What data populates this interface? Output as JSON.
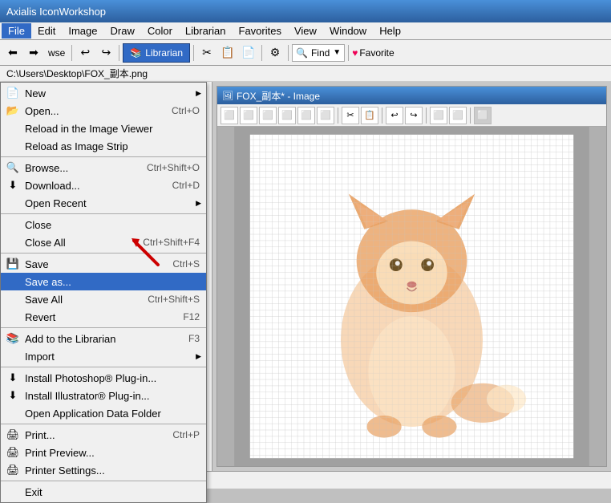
{
  "app": {
    "title": "Axialis IconWorkshop",
    "inner_window_title": "FOX_副本* - Image",
    "path": "C:\\Users\\Desktop\\FOX_副本.png"
  },
  "menu_bar": {
    "items": [
      {
        "id": "file",
        "label": "File",
        "active": true
      },
      {
        "id": "edit",
        "label": "Edit"
      },
      {
        "id": "image",
        "label": "Image"
      },
      {
        "id": "draw",
        "label": "Draw"
      },
      {
        "id": "color",
        "label": "Color"
      },
      {
        "id": "librarian",
        "label": "Librarian"
      },
      {
        "id": "favorites",
        "label": "Favorites"
      },
      {
        "id": "view",
        "label": "View"
      },
      {
        "id": "window",
        "label": "Window"
      },
      {
        "id": "help",
        "label": "Help"
      }
    ]
  },
  "toolbar": {
    "librarian_label": "Librarian",
    "find_label": "Find",
    "favorites_label": "Favorite"
  },
  "file_menu": {
    "items": [
      {
        "id": "new",
        "label": "New",
        "shortcut": "",
        "has_submenu": true,
        "has_icon": true
      },
      {
        "id": "open",
        "label": "Open...",
        "shortcut": "Ctrl+O",
        "has_icon": true
      },
      {
        "id": "reload-viewer",
        "label": "Reload in the Image Viewer",
        "shortcut": "",
        "has_icon": false
      },
      {
        "id": "reload-strip",
        "label": "Reload as Image Strip",
        "shortcut": "",
        "has_icon": false
      },
      {
        "id": "sep1",
        "type": "separator"
      },
      {
        "id": "browse",
        "label": "Browse...",
        "shortcut": "Ctrl+Shift+O",
        "has_icon": true
      },
      {
        "id": "download",
        "label": "Download...",
        "shortcut": "Ctrl+D",
        "has_icon": true
      },
      {
        "id": "open-recent",
        "label": "Open Recent",
        "shortcut": "",
        "has_submenu": true,
        "has_icon": false
      },
      {
        "id": "sep2",
        "type": "separator"
      },
      {
        "id": "close",
        "label": "Close",
        "shortcut": ""
      },
      {
        "id": "close-all",
        "label": "Close All",
        "shortcut": "Ctrl+Shift+F4"
      },
      {
        "id": "sep3",
        "type": "separator"
      },
      {
        "id": "save",
        "label": "Save",
        "shortcut": "Ctrl+S",
        "has_icon": true
      },
      {
        "id": "save-as",
        "label": "Save as...",
        "shortcut": "",
        "highlighted": true,
        "has_icon": false
      },
      {
        "id": "save-all",
        "label": "Save All",
        "shortcut": "Ctrl+Shift+S",
        "has_icon": false
      },
      {
        "id": "revert",
        "label": "Revert",
        "shortcut": "F12"
      },
      {
        "id": "sep4",
        "type": "separator"
      },
      {
        "id": "add-librarian",
        "label": "Add to the Librarian",
        "shortcut": "F3",
        "has_icon": true
      },
      {
        "id": "import",
        "label": "Import",
        "shortcut": "",
        "has_submenu": true,
        "has_icon": false
      },
      {
        "id": "sep5",
        "type": "separator"
      },
      {
        "id": "install-photoshop",
        "label": "Install Photoshop® Plug-in...",
        "has_icon": true
      },
      {
        "id": "install-illustrator",
        "label": "Install Illustrator® Plug-in...",
        "has_icon": true
      },
      {
        "id": "open-data-folder",
        "label": "Open Application Data Folder",
        "has_icon": false
      },
      {
        "id": "sep6",
        "type": "separator"
      },
      {
        "id": "print",
        "label": "Print...",
        "shortcut": "Ctrl+P",
        "has_icon": true
      },
      {
        "id": "print-preview",
        "label": "Print Preview...",
        "has_icon": true
      },
      {
        "id": "printer-settings",
        "label": "Printer Settings...",
        "has_icon": true
      },
      {
        "id": "sep7",
        "type": "separator"
      },
      {
        "id": "exit",
        "label": "Exit",
        "has_icon": false
      }
    ]
  },
  "colors": {
    "highlight": "#316ac5",
    "highlight_text": "#ffffff",
    "menu_bg": "#f0f0f0",
    "border": "#777777"
  }
}
